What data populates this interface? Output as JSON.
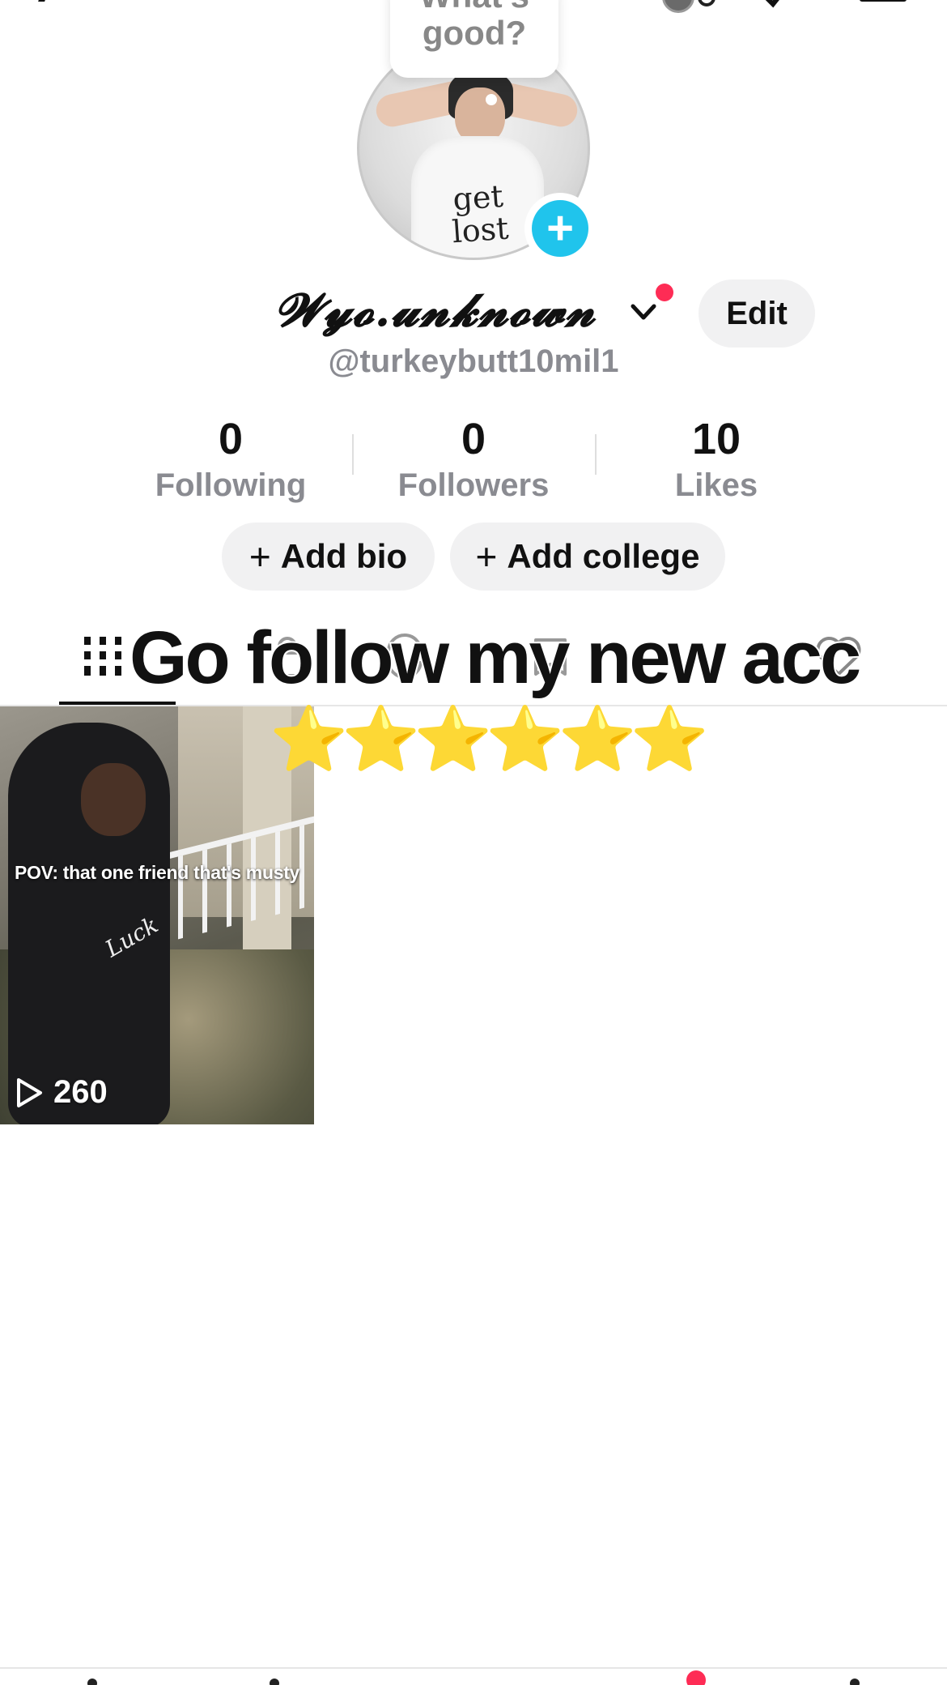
{
  "profile": {
    "status_bubble_line1": "What's",
    "status_bubble_line2": "good?",
    "display_name": "𝓦𝔂𝓸.𝓾𝓷𝓴𝓷𝓸𝔀𝓷",
    "handle": "@turkeybutt10mil1",
    "edit_label": "Edit",
    "add_bio_label": "Add bio",
    "add_college_label": "Add college",
    "avatar_shirt_text": "get lost"
  },
  "stats": [
    {
      "value": "0",
      "label": "Following"
    },
    {
      "value": "0",
      "label": "Followers"
    },
    {
      "value": "10",
      "label": "Likes"
    }
  ],
  "overlay": {
    "text": "Go follow my new acc",
    "stars": "⭐⭐⭐⭐⭐⭐"
  },
  "tabs": {
    "icons": [
      "grid-icon",
      "lock-icon",
      "repost-icon",
      "favorites-icon",
      "liked-heart-icon"
    ],
    "active": "grid-icon"
  },
  "videos": [
    {
      "caption": "POV: that one friend that's musty",
      "views": "260",
      "logo_text": "Luck"
    }
  ],
  "colors": {
    "accent_blue": "#20c4ec",
    "notification_red": "#fe2c55",
    "muted_text": "#8a8b91",
    "pill_bg": "#f1f1f2"
  }
}
